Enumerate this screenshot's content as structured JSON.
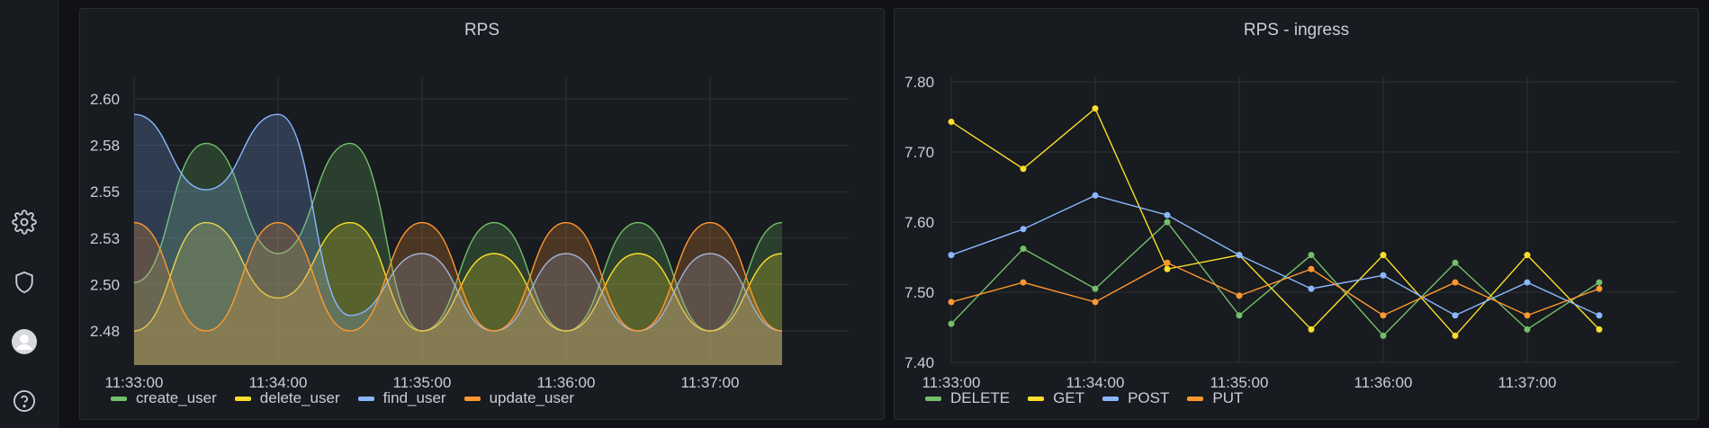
{
  "sidebar": {
    "icons": [
      "gear-icon",
      "shield-icon",
      "avatar",
      "help-icon"
    ]
  },
  "panels": [
    {
      "title": "RPS",
      "legend": [
        {
          "label": "create_user",
          "color": "#73bf69"
        },
        {
          "label": "delete_user",
          "color": "#fade2a"
        },
        {
          "label": "find_user",
          "color": "#8ab8ff"
        },
        {
          "label": "update_user",
          "color": "#ff9830"
        }
      ]
    },
    {
      "title": "RPS - ingress",
      "legend": [
        {
          "label": "DELETE",
          "color": "#73bf69"
        },
        {
          "label": "GET",
          "color": "#fade2a"
        },
        {
          "label": "POST",
          "color": "#8ab8ff"
        },
        {
          "label": "PUT",
          "color": "#ff9830"
        }
      ]
    }
  ],
  "chart_data": [
    {
      "type": "area",
      "title": "RPS",
      "x": [
        "11:33:00",
        "11:33:30",
        "11:34:00",
        "11:34:30",
        "11:35:00",
        "11:35:30",
        "11:36:00",
        "11:36:30",
        "11:37:00",
        "11:37:30"
      ],
      "xticks": [
        "11:33:00",
        "11:34:00",
        "11:35:00",
        "11:36:00",
        "11:37:00"
      ],
      "yticks": [
        "2.48",
        "2.50",
        "2.53",
        "2.55",
        "2.58",
        "2.60"
      ],
      "ylim": [
        2.467,
        2.612
      ],
      "series": [
        {
          "name": "create_user",
          "color": "#73bf69",
          "values": [
            2.505,
            2.577,
            2.52,
            2.577,
            2.48,
            2.536,
            2.48,
            2.536,
            2.48,
            2.536
          ]
        },
        {
          "name": "delete_user",
          "color": "#fade2a",
          "values": [
            2.48,
            2.536,
            2.497,
            2.536,
            2.48,
            2.52,
            2.48,
            2.52,
            2.48,
            2.52
          ]
        },
        {
          "name": "find_user",
          "color": "#8ab8ff",
          "values": [
            2.592,
            2.553,
            2.592,
            2.488,
            2.52,
            2.48,
            2.52,
            2.48,
            2.52,
            2.48
          ]
        },
        {
          "name": "update_user",
          "color": "#ff9830",
          "values": [
            2.536,
            2.48,
            2.536,
            2.48,
            2.536,
            2.48,
            2.536,
            2.48,
            2.536,
            2.48
          ]
        }
      ],
      "legend_position": "bottom-left",
      "grid": true
    },
    {
      "type": "line",
      "title": "RPS - ingress",
      "x": [
        "11:33:00",
        "11:33:30",
        "11:34:00",
        "11:34:30",
        "11:35:00",
        "11:35:30",
        "11:36:00",
        "11:36:30",
        "11:37:00",
        "11:37:30"
      ],
      "xticks": [
        "11:33:00",
        "11:34:00",
        "11:35:00",
        "11:36:00",
        "11:37:00"
      ],
      "yticks": [
        "7.40",
        "7.50",
        "7.60",
        "7.70",
        "7.80"
      ],
      "ylim": [
        7.4,
        7.8
      ],
      "series": [
        {
          "name": "DELETE",
          "color": "#73bf69",
          "values": [
            7.455,
            7.562,
            7.505,
            7.6,
            7.467,
            7.553,
            7.438,
            7.542,
            7.447,
            7.514
          ]
        },
        {
          "name": "GET",
          "color": "#fade2a",
          "values": [
            7.743,
            7.676,
            7.762,
            7.533,
            7.553,
            7.447,
            7.553,
            7.438,
            7.553,
            7.447
          ]
        },
        {
          "name": "POST",
          "color": "#8ab8ff",
          "values": [
            7.553,
            7.59,
            7.638,
            7.61,
            7.553,
            7.505,
            7.524,
            7.467,
            7.514,
            7.467
          ]
        },
        {
          "name": "PUT",
          "color": "#ff9830",
          "values": [
            7.486,
            7.514,
            7.486,
            7.542,
            7.495,
            7.533,
            7.467,
            7.514,
            7.467,
            7.505
          ]
        }
      ],
      "legend_position": "bottom-left",
      "grid": true
    }
  ]
}
